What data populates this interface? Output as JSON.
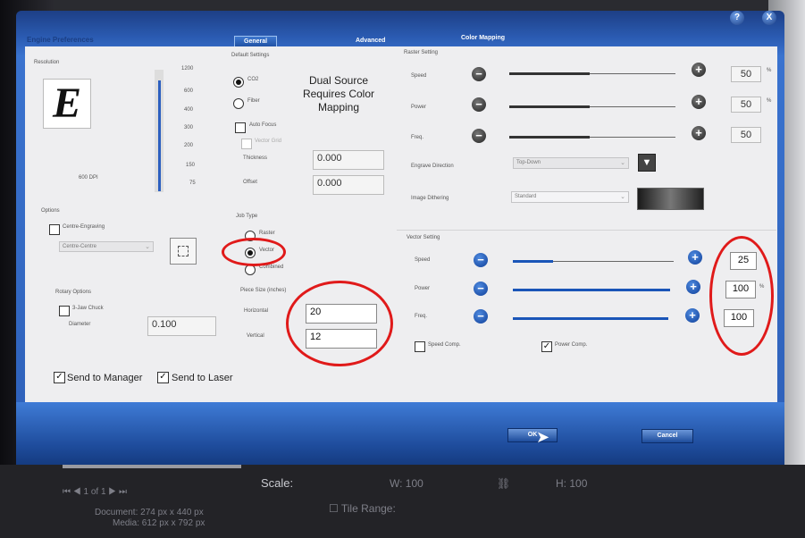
{
  "dialog": {
    "title": "Engine Preferences",
    "tabs": {
      "general": "General",
      "advanced": "Advanced",
      "color_mapping": "Color Mapping"
    },
    "help_icon": "?",
    "close_icon": "X"
  },
  "resolution": {
    "label": "Resolution",
    "preview_letter": "E",
    "dpi_text": "600 DPI",
    "marks": [
      "1200",
      "600",
      "400",
      "300",
      "200",
      "150",
      "75"
    ]
  },
  "default_settings": {
    "label": "Default Settings",
    "co2": "CO2",
    "fiber": "Fiber",
    "auto_focus": "Auto Focus",
    "vector_grid": "Vector Grid",
    "thickness_label": "Thickness",
    "thickness_value": "0.000",
    "offset_label": "Offset",
    "offset_value": "0.000",
    "dual_source_note": "Dual Source Requires Color Mapping"
  },
  "options": {
    "label": "Options",
    "centre_engraving": "Centre-Engraving",
    "centre_combo": "Centre-Centre"
  },
  "rotary": {
    "label": "Rotary Options",
    "nbsp": "",
    "chuck": "3-Jaw Chuck",
    "diameter_label": "Diameter",
    "diameter_value": "0.100"
  },
  "job_type": {
    "label": "Job Type",
    "raster": "Raster",
    "vector": "Vector",
    "combined": "Combined",
    "selected": "Vector"
  },
  "piece_size": {
    "label": "Piece Size (inches)",
    "horizontal_label": "Horizontal",
    "horizontal_value": "20",
    "vertical_label": "Vertical",
    "vertical_value": "12"
  },
  "raster_setting": {
    "label": "Raster Setting",
    "speed_label": "Speed",
    "speed_value": "50",
    "power_label": "Power",
    "power_value": "50",
    "freq_label": "Freq.",
    "freq_value": "50",
    "percent": "%",
    "engrave_direction_label": "Engrave Direction",
    "engrave_direction_value": "Top-Down",
    "image_dithering_label": "Image Dithering",
    "image_dithering_value": "Standard"
  },
  "vector_setting": {
    "label": "Vector Setting",
    "speed_label": "Speed",
    "speed_value": "25",
    "speed_level": 0.25,
    "power_label": "Power",
    "power_value": "100",
    "power_level": 1.0,
    "freq_label": "Freq.",
    "freq_value": "100",
    "freq_level": 1.0,
    "percent": "%",
    "speed_comp": "Speed Comp.",
    "power_comp": "Power Comp."
  },
  "send": {
    "to_manager": "Send to Manager",
    "to_laser": "Send to Laser"
  },
  "footer": {
    "ok": "OK",
    "cancel": "Cancel"
  },
  "background": {
    "scale_label": "Scale:",
    "w_label": "W:",
    "w_value": "100",
    "h_label": "H:",
    "h_value": "100",
    "tile_range": "Tile Range:",
    "page_indicator": "1 of 1",
    "document": "Document: 274 px x 440 px",
    "media": "Media: 612 px x 792 px"
  },
  "colors": {
    "dialog_blue": "#2b5cb3",
    "annotation_red": "#e01a1a",
    "panel_bg": "#eeeef0"
  }
}
